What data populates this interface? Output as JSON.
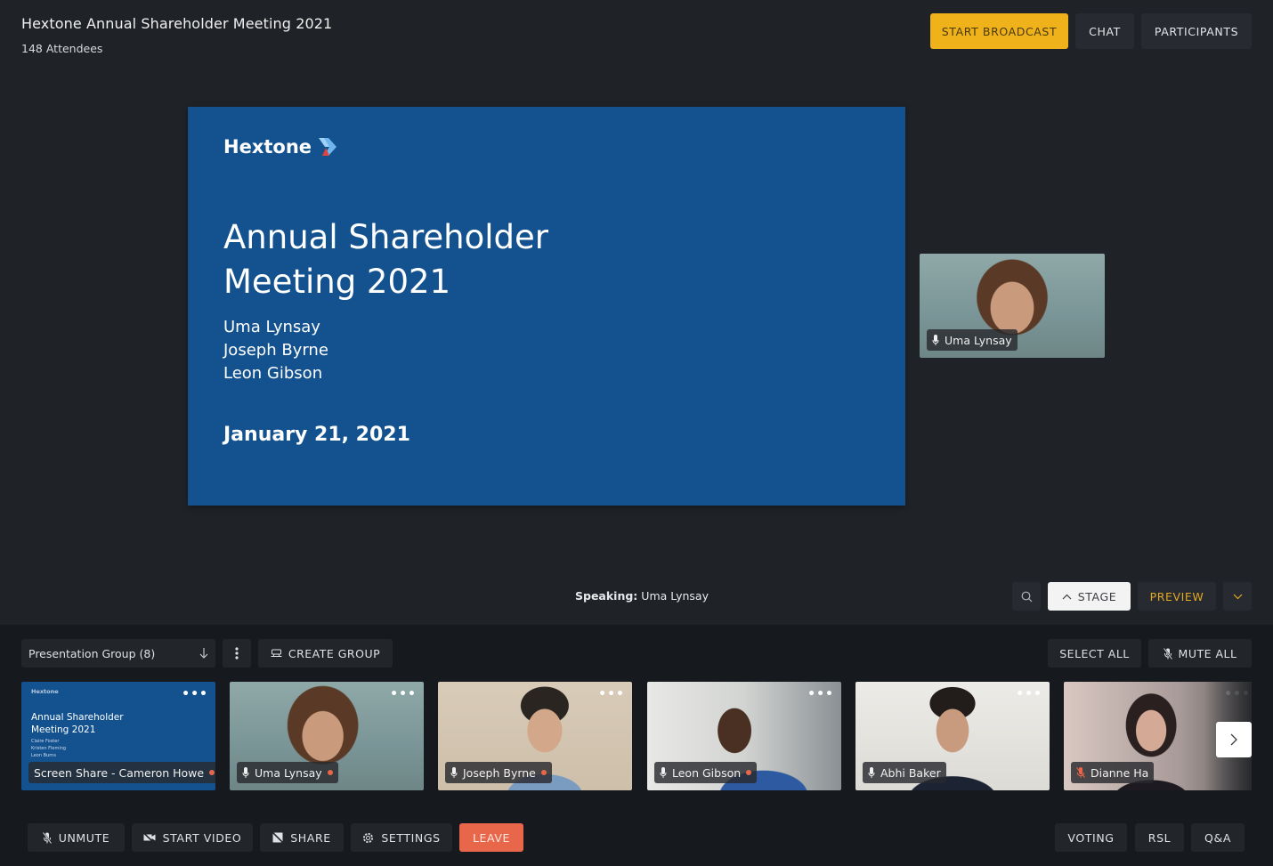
{
  "header": {
    "title": "Hextone Annual Shareholder Meeting 2021",
    "attendees": "148 Attendees",
    "buttons": {
      "start_broadcast": "START BROADCAST",
      "chat": "CHAT",
      "participants": "PARTICIPANTS"
    }
  },
  "colors": {
    "accent": "#f0b21a",
    "slide_blue": "#13528f",
    "leave": "#e8664a",
    "preview": "#e2a923"
  },
  "slide": {
    "logo_text": "Hextone",
    "heading_line1": "Annual Shareholder",
    "heading_line2": "Meeting 2021",
    "presenters": [
      "Uma Lynsay",
      "Joseph Byrne",
      "Leon Gibson"
    ],
    "date": "January 21, 2021"
  },
  "active_speaker": {
    "name": "Uma Lynsay",
    "mic_icon": "microphone-icon"
  },
  "stage_controls": {
    "speaking_label": "Speaking:",
    "speaking_name": "Uma Lynsay",
    "stage": "STAGE",
    "preview": "PREVIEW"
  },
  "participants_panel": {
    "group_select": "Presentation Group (8)",
    "create_group": "CREATE GROUP",
    "select_all": "SELECT ALL",
    "mute_all": "MUTE ALL",
    "tiles": [
      {
        "name": "Screen Share - Cameron Howe",
        "type": "screen-share",
        "live": true,
        "mini_logo": "Hextone",
        "mini_heading_1": "Annual Shareholder",
        "mini_heading_2": "Meeting 2021",
        "mini_names": [
          "Claire Foster",
          "Kristen Fleming",
          "Leon Burns"
        ]
      },
      {
        "name": "Uma Lynsay",
        "mic": "on",
        "live": true
      },
      {
        "name": "Joseph Byrne",
        "mic": "on",
        "live": true
      },
      {
        "name": "Leon Gibson",
        "mic": "on",
        "live": true
      },
      {
        "name": "Abhi Baker",
        "mic": "on",
        "live": false
      },
      {
        "name": "Dianne Ha",
        "mic": "muted",
        "live": false
      }
    ],
    "more_label": "•••"
  },
  "bottom_bar": {
    "unmute": "UNMUTE",
    "start_video": "START VIDEO",
    "share": "SHARE",
    "settings": "SETTINGS",
    "leave": "LEAVE",
    "voting": "VOTING",
    "rsl": "RSL",
    "qa": "Q&A"
  }
}
